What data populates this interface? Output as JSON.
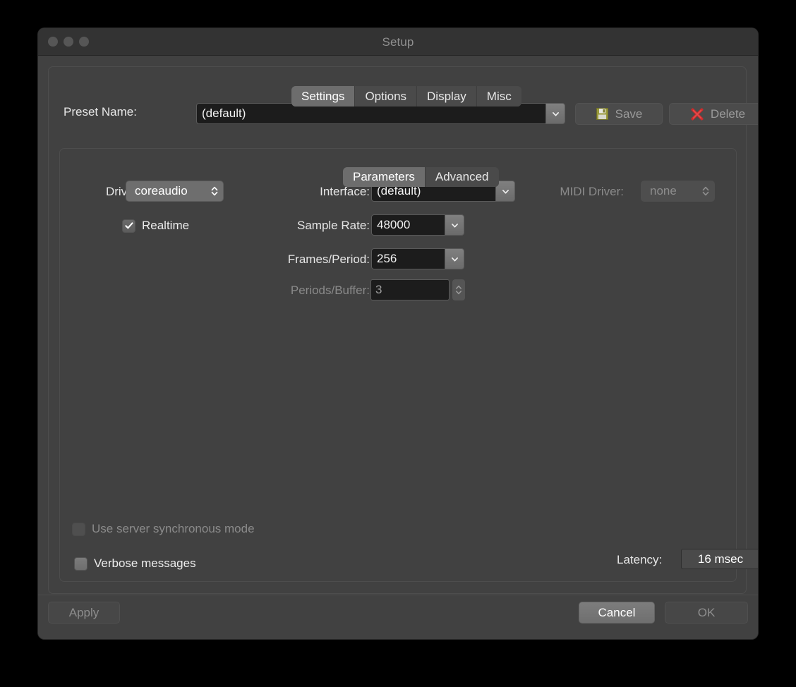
{
  "window": {
    "title": "Setup",
    "traffic_lights": [
      "close",
      "minimize",
      "zoom"
    ]
  },
  "main_tabs": [
    {
      "label": "Settings",
      "active": true
    },
    {
      "label": "Options",
      "active": false
    },
    {
      "label": "Display",
      "active": false
    },
    {
      "label": "Misc",
      "active": false
    }
  ],
  "preset": {
    "label": "Preset Name:",
    "value": "(default)",
    "save_label": "Save",
    "delete_label": "Delete"
  },
  "param_tabs": [
    {
      "label": "Parameters",
      "active": true
    },
    {
      "label": "Advanced",
      "active": false
    }
  ],
  "fields": {
    "driver": {
      "label": "Driver:",
      "value": "coreaudio"
    },
    "interface": {
      "label": "Interface:",
      "value": "(default)"
    },
    "midi_driver": {
      "label": "MIDI Driver:",
      "value": "none"
    },
    "realtime": {
      "label": "Realtime",
      "checked": true
    },
    "sample_rate": {
      "label": "Sample Rate:",
      "value": "48000"
    },
    "frames_period": {
      "label": "Frames/Period:",
      "value": "256"
    },
    "periods_buffer": {
      "label": "Periods/Buffer:",
      "value": "3"
    },
    "server_sync": {
      "label": "Use server synchronous mode",
      "checked": false
    },
    "verbose": {
      "label": "Verbose messages",
      "checked": false
    },
    "latency": {
      "label": "Latency:",
      "value": "16 msec"
    }
  },
  "footer": {
    "apply_label": "Apply",
    "cancel_label": "Cancel",
    "ok_label": "OK"
  },
  "colors": {
    "window_bg": "#414141",
    "titlebar_bg": "#333333",
    "field_bg": "#1c1c1c",
    "accent_save_icon": "#a8a84a",
    "accent_delete_icon": "#cc2b2b",
    "text": "#e6e6e6",
    "text_disabled": "#8a8a8a"
  }
}
